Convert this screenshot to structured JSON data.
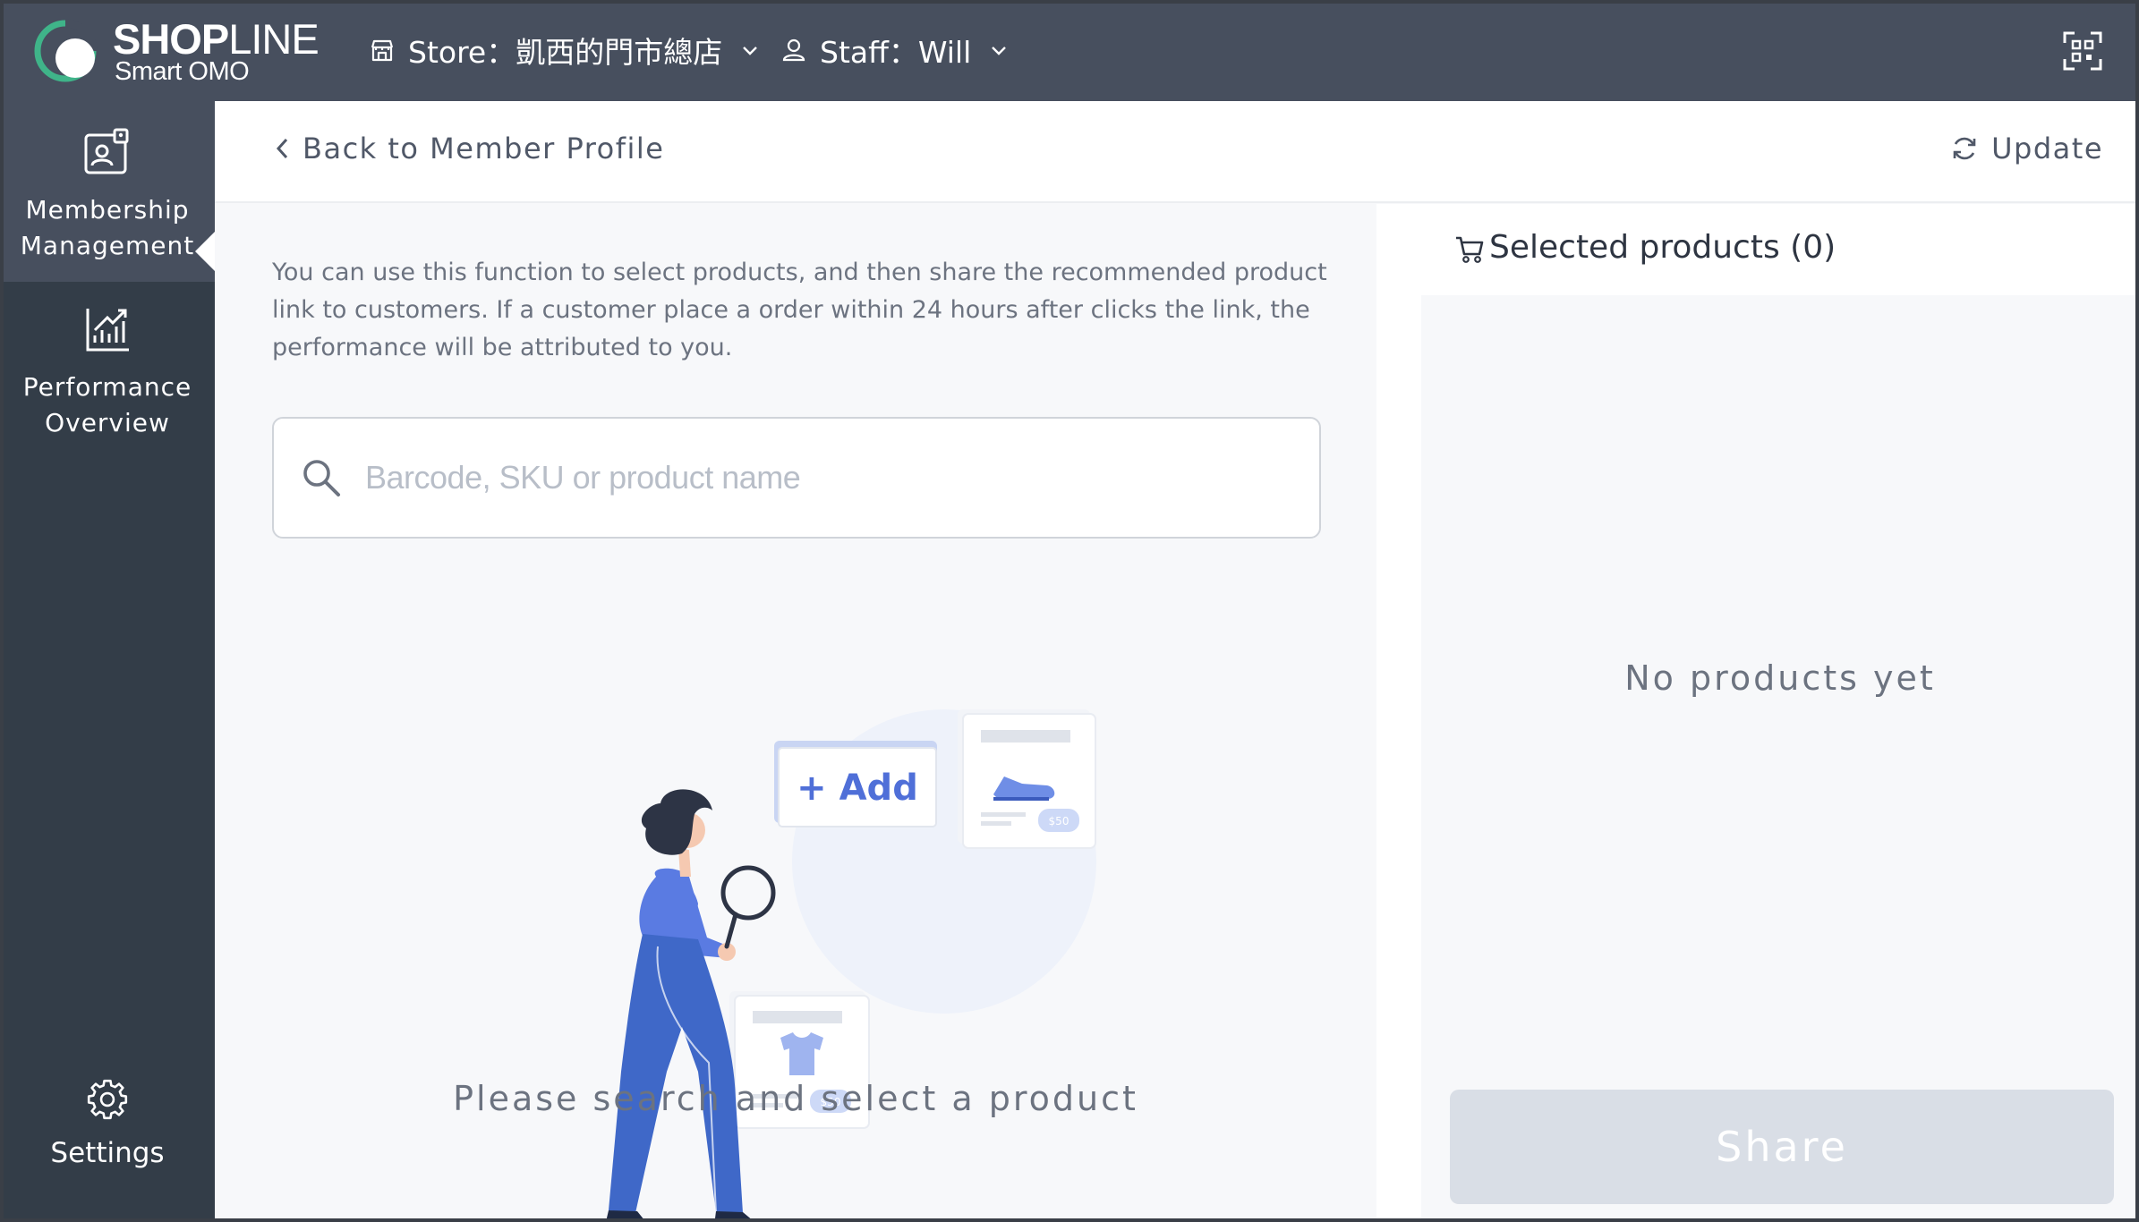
{
  "brand": {
    "name_bold": "SH",
    "name_o": "O",
    "name_rest_bold": "P",
    "name_thin": "LINE",
    "subtitle": "Smart OMO"
  },
  "topbar": {
    "store_label": "Store：凱西的門市總店",
    "staff_label": "Staff：Will"
  },
  "sidebar": {
    "items": [
      {
        "label": "Membership\nManagement",
        "icon": "member-card-icon",
        "active": true
      },
      {
        "label": "Performance\nOverview",
        "icon": "chart-up-icon",
        "active": false
      },
      {
        "label": "Settings",
        "icon": "gear-icon",
        "active": false
      }
    ]
  },
  "header": {
    "back_label": "Back to Member Profile",
    "update_label": "Update"
  },
  "main": {
    "intro_text": "You can use this function to select products, and then share the recommended product link to customers. If a customer place a order within 24 hours after clicks the link, the performance will be attributed to you.",
    "search_placeholder": "Barcode, SKU or product name",
    "search_value": "",
    "illustration": {
      "add_label": "+ Add",
      "price_tag": "$50"
    },
    "empty_message": "Please search and select a product"
  },
  "selected": {
    "title": "Selected products (0)",
    "empty_message": "No products yet",
    "share_label": "Share"
  },
  "colors": {
    "topbar": "#474f5e",
    "sidebar": "#333d48",
    "brand_green": "#3fb489",
    "illustration_blue": "#4f6fd8",
    "share_disabled": "#d9dee6"
  }
}
